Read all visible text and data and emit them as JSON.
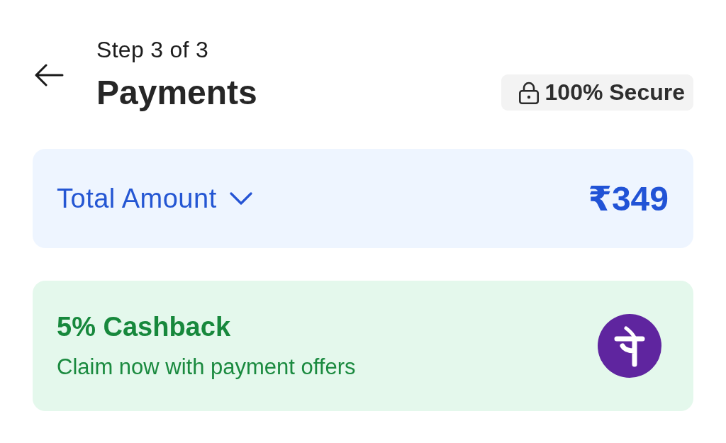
{
  "header": {
    "step": "Step 3 of 3",
    "title": "Payments",
    "secure_badge": "100% Secure"
  },
  "total": {
    "label": "Total Amount",
    "expanded": false,
    "amount": "₹349"
  },
  "offer": {
    "title": "5% Cashback",
    "subtitle": "Claim now with payment offers"
  }
}
